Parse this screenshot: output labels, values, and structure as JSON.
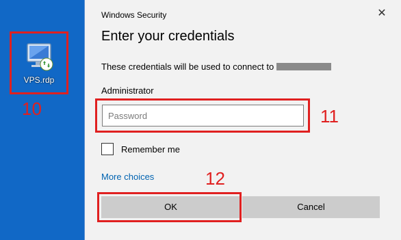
{
  "desktop": {
    "icon_label": "VPS.rdp",
    "icon_name": "remote-desktop-file-icon"
  },
  "annotations": {
    "step_icon": "10",
    "step_password": "11",
    "step_ok": "12",
    "color": "#e02020"
  },
  "dialog": {
    "title": "Windows Security",
    "close_glyph": "✕",
    "heading": "Enter your credentials",
    "info_text": "These credentials will be used to connect to",
    "username": "Administrator",
    "password_placeholder": "Password",
    "remember_label": "Remember me",
    "more_choices": "More choices",
    "ok_label": "OK",
    "cancel_label": "Cancel"
  },
  "colors": {
    "desktop_bg": "#1168c6",
    "dialog_bg": "#f2f2f2",
    "button_bg": "#cccccc",
    "link": "#0063b1"
  }
}
